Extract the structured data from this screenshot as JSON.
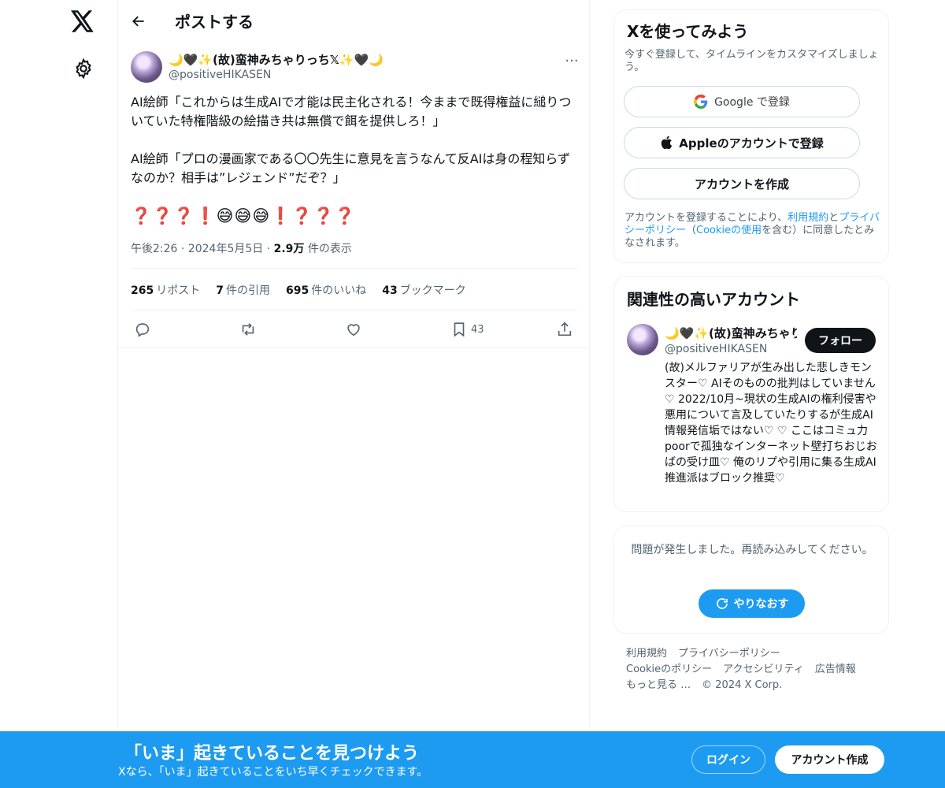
{
  "colors": {
    "accent": "#1d9bf0",
    "text": "#0f1419",
    "muted": "#536471",
    "border": "#eff3f4"
  },
  "nav": {
    "logo_icon": "x-logo-icon",
    "settings_icon": "gear-icon"
  },
  "header": {
    "title": "ポストする",
    "back_icon": "arrow-left-icon"
  },
  "tweet": {
    "author_name": "🌙🖤✨(故)蛮神みちゃりっち𝕏✨🖤🌙",
    "author_handle": "@positiveHIKASEN",
    "more_icon": "more-icon",
    "text": "AI絵師「これからは生成AIで才能は民主化される！今ままで既得権益に縋りついていた特権階級の絵描き共は無償で餌を提供しろ！」\n\nAI絵師「プロの漫画家である〇〇先生に意見を言うなんて反AIは身の程知らずなのか？相手は”レジェンド”だぞ？」",
    "emoji_line": "❓❓❓❗😅😅😅❗❓❓❓",
    "time": "午後2:26",
    "date": "2024年5月5日",
    "views_count": "2.9万",
    "views_label": "件の表示",
    "separator": "·",
    "stats": [
      {
        "count": "265",
        "label": "リポスト"
      },
      {
        "count": "7",
        "label": "件の引用"
      },
      {
        "count": "695",
        "label": "件のいいね"
      },
      {
        "count": "43",
        "label": "ブックマーク"
      }
    ],
    "actions": {
      "reply_icon": "reply-icon",
      "repost_icon": "repost-icon",
      "like_icon": "heart-icon",
      "bookmark_icon": "bookmark-icon",
      "bookmark_count": "43",
      "share_icon": "share-icon"
    }
  },
  "signup_card": {
    "title": "Xを使ってみよう",
    "subtitle": "今すぐ登録して、タイムラインをカスタマイズしましょう。",
    "google_label": "Google で登録",
    "apple_label": "Appleのアカウントで登録",
    "create_label": "アカウントを作成",
    "legal_prefix": "アカウントを登録することにより、",
    "terms_link": "利用規約",
    "legal_and": "と",
    "privacy_link": "プライバシーポリシー",
    "legal_paren_open": "（",
    "cookie_link": "Cookieの使用",
    "legal_suffix": "を含む）に同意したとみなされます。"
  },
  "related": {
    "title": "関連性の高いアカウント",
    "name": "🌙🖤✨(故)蛮神みちゃりっち𝕏✨🖤🌙",
    "handle": "@positiveHIKASEN",
    "follow_label": "フォロー",
    "bio": "(故)メルファリアが生み出した悲しきモンスター♡ AIそのものの批判はしていません♡ 2022/10月~現状の生成AIの権利侵害や悪用について言及していたりするが生成AI情報発信垢ではない♡ ♡ ここはコミュ力poorで孤独なインターネット壁打ちおじおばの受け皿♡ 俺のリプや引用に集る生成AI推進派はブロック推奨♡"
  },
  "error_card": {
    "message": "問題が発生しました。再読み込みしてください。",
    "retry_label": "やりなおす"
  },
  "footer": {
    "links": [
      "利用規約",
      "プライバシーポリシー",
      "Cookieのポリシー",
      "アクセシビリティ",
      "広告情報",
      "もっと見る …"
    ],
    "copyright": "© 2024 X Corp."
  },
  "banner": {
    "title": "「いま」起きていることを見つけよう",
    "subtitle": "Xなら、「いま」起きていることをいち早くチェックできます。",
    "login_label": "ログイン",
    "signup_label": "アカウント作成"
  }
}
